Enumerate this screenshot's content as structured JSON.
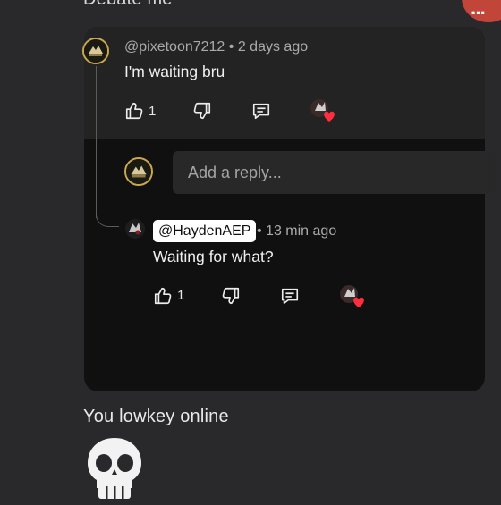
{
  "header": {
    "previous_comment_fragment": "Debate me"
  },
  "parent_comment": {
    "author": "@pixetoon7212",
    "time": "2 days ago",
    "text": "I'm waiting bru",
    "likes": "1"
  },
  "reply_input": {
    "placeholder": "Add a reply..."
  },
  "reply_comment": {
    "author": "@HaydenAEP",
    "time": "13 min ago",
    "text": "Waiting for what?",
    "likes": "1"
  },
  "next_comment": {
    "text": "You lowkey online",
    "emoji": "💀"
  },
  "colors": {
    "background": "#29292b",
    "thread_card": "#101010",
    "parent_highlight": "#232323",
    "creator_heart": "#ff2d3d",
    "avatar_ring": "#c9a84e"
  },
  "icons": [
    "thumbs-up-icon",
    "thumbs-down-icon",
    "reply-comment-icon",
    "creator-heart-icon"
  ]
}
